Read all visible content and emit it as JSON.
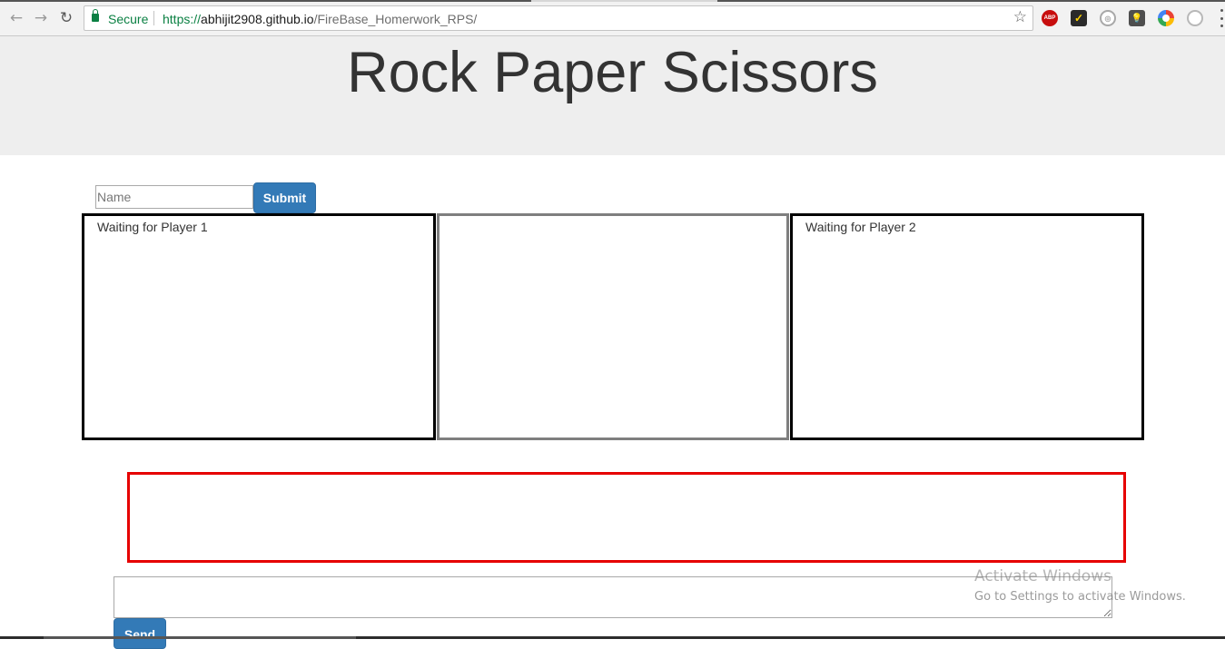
{
  "browser": {
    "secure_label": "Secure",
    "url_scheme": "https://",
    "url_host": "abhijit2908.github.io",
    "url_path": "/FireBase_Homerwork_RPS/",
    "icons": [
      "back-arrow-icon",
      "forward-arrow-icon",
      "reload-icon",
      "lock-icon",
      "bookmark-star-icon",
      "adblock-plus-icon",
      "checkmark-extension-icon",
      "extension-circle-icon",
      "lightbulb-extension-icon",
      "color-wheel-extension-icon",
      "grey-circle-extension-icon",
      "more-menu-icon"
    ],
    "extensions": {
      "abp": "ABP",
      "check": "✓",
      "round": "◎",
      "bulb": "💡"
    }
  },
  "page": {
    "title": "Rock Paper Scissors",
    "name_placeholder": "Name",
    "submit_label": "Submit",
    "player1_status": "Waiting for Player 1",
    "player2_status": "Waiting for Player 2",
    "send_label": "Send"
  },
  "colors": {
    "primary_button": "#337ab7",
    "jumbotron_bg": "#eeeeee",
    "result_border": "#e60000"
  },
  "os_overlay": {
    "activate_title": "Activate Windows",
    "activate_subtitle": "Go to Settings to activate Windows."
  }
}
